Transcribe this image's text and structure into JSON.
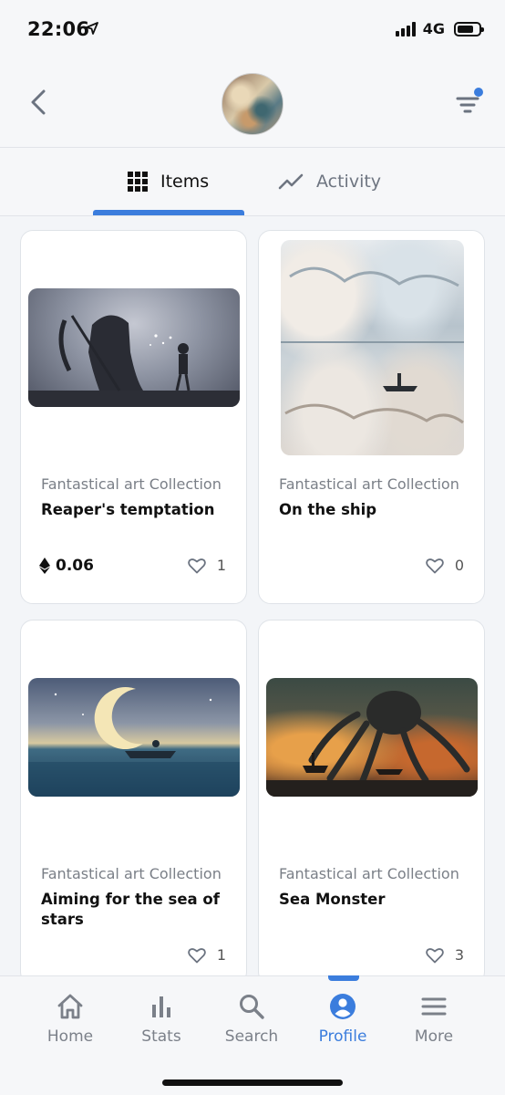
{
  "status_bar": {
    "time": "22:06",
    "network": "4G"
  },
  "header": {
    "back_icon": "chevron-left-icon",
    "filter_icon": "filter-icon",
    "avatar": "collection-avatar"
  },
  "tabs": [
    {
      "label": "Items",
      "icon": "grid-icon",
      "active": true
    },
    {
      "label": "Activity",
      "icon": "trend-line-icon",
      "active": false
    }
  ],
  "items": [
    {
      "collection": "Fantastical art Collection",
      "title": "Reaper's temptation",
      "price": "0.06",
      "likes": "1"
    },
    {
      "collection": "Fantastical art Collection",
      "title": "On the ship",
      "price": "",
      "likes": "0"
    },
    {
      "collection": "Fantastical art Collection",
      "title": "Aiming for the sea of stars",
      "price": "",
      "likes": "1"
    },
    {
      "collection": "Fantastical art Collection",
      "title": "Sea Monster",
      "price": "",
      "likes": "3"
    }
  ],
  "bottom_nav": [
    {
      "label": "Home",
      "icon": "home-icon",
      "active": false
    },
    {
      "label": "Stats",
      "icon": "bar-chart-icon",
      "active": false
    },
    {
      "label": "Search",
      "icon": "search-icon",
      "active": false
    },
    {
      "label": "Profile",
      "icon": "user-icon",
      "active": true
    },
    {
      "label": "More",
      "icon": "menu-icon",
      "active": false
    }
  ],
  "colors": {
    "accent": "#3b7ddd",
    "background": "#f3f5f8",
    "card": "#ffffff",
    "muted_text": "#7a7f87"
  }
}
